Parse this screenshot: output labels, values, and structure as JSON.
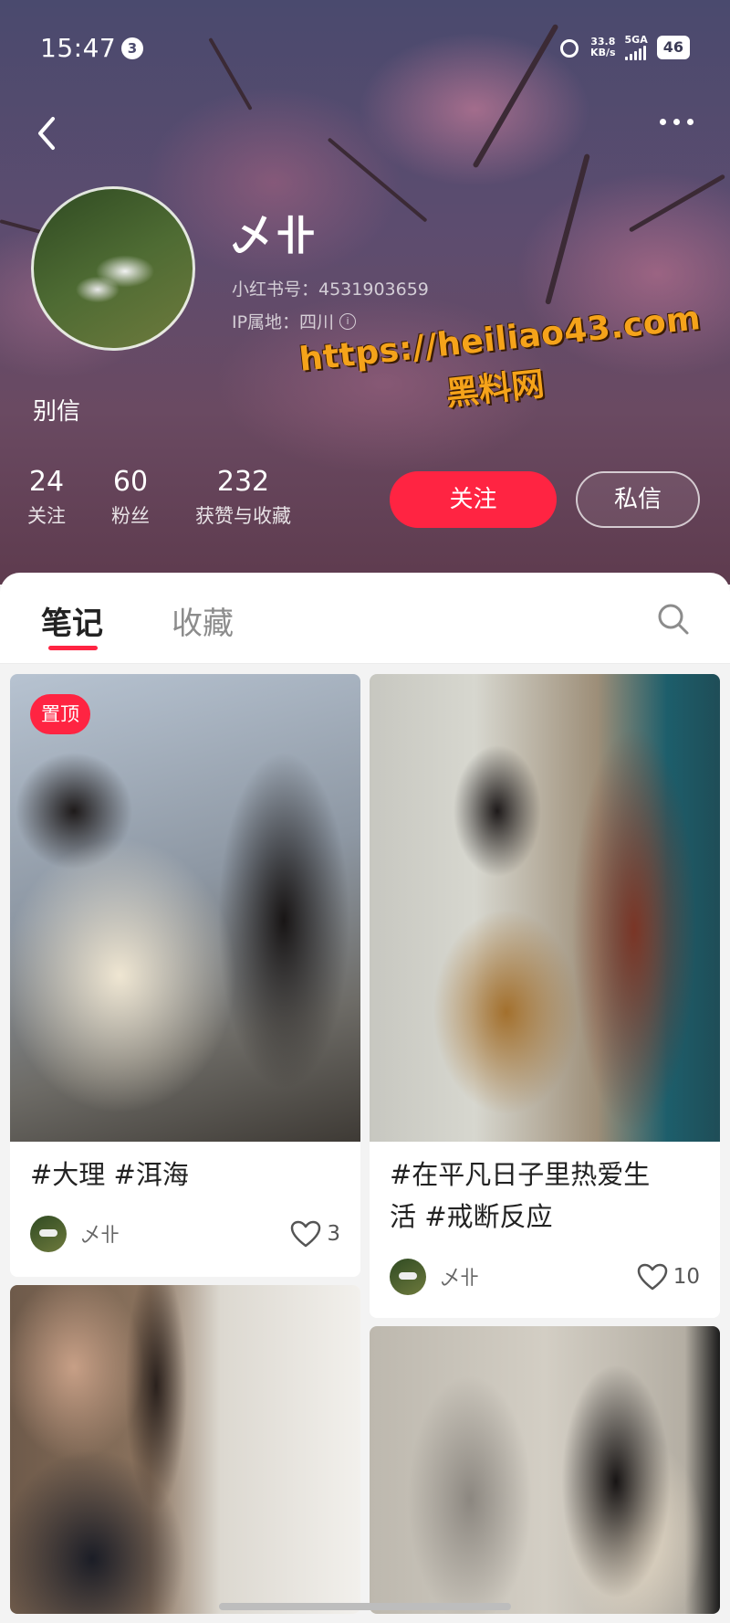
{
  "status_bar": {
    "time": "15:47",
    "notification_count": "3",
    "speed_value": "33.8",
    "speed_unit": "KB/s",
    "network": "5GA",
    "battery": "46"
  },
  "profile": {
    "nickname": "乄卝",
    "user_id": "小红书号：4531903659",
    "ip_location": "IP属地：四川",
    "bio": "别信"
  },
  "stats": [
    {
      "value": "24",
      "label": "关注"
    },
    {
      "value": "60",
      "label": "粉丝"
    },
    {
      "value": "232",
      "label": "获赞与收藏"
    }
  ],
  "actions": {
    "follow": "关注",
    "message": "私信"
  },
  "watermark": {
    "url": "https://heiliao43.com",
    "name": "黑料网"
  },
  "tabs": [
    {
      "label": "笔记",
      "active": true
    },
    {
      "label": "收藏",
      "active": false
    }
  ],
  "notes": [
    {
      "pinned": true,
      "pin_label": "置顶",
      "title": "#大理 #洱海",
      "author": "乄卝",
      "likes": "3"
    },
    {
      "pinned": false,
      "title_line1": "#在平凡日子里热爱生",
      "title_line2": "活 #戒断反应",
      "author": "乄卝",
      "likes": "10"
    },
    {
      "pinned": false
    },
    {
      "pinned": false
    }
  ],
  "icons": {
    "back": "chevron-left-icon",
    "more": "more-dots-icon",
    "search": "search-icon",
    "like": "heart-outline-icon",
    "info": "info-icon",
    "alarm": "alarm-icon"
  },
  "colors": {
    "accent": "#ff2442"
  }
}
